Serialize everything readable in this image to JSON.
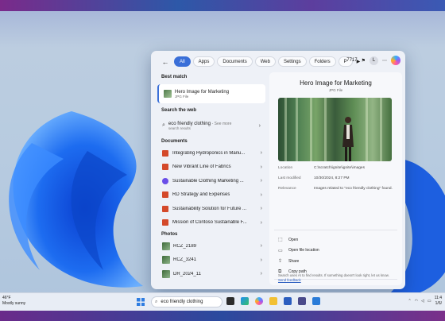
{
  "filters": {
    "tabs": [
      {
        "label": "All",
        "active": true
      },
      {
        "label": "Apps"
      },
      {
        "label": "Documents"
      },
      {
        "label": "Web"
      },
      {
        "label": "Settings"
      },
      {
        "label": "Folders"
      },
      {
        "label": "P"
      }
    ],
    "count": "7717",
    "avatar": "L"
  },
  "best_match": {
    "section": "Best match",
    "title": "Hero Image for Marketing",
    "subtitle": "JPG File"
  },
  "web": {
    "section": "Search the web",
    "query": "eco friendly clothing",
    "more": "- See more",
    "subtitle": "search results"
  },
  "documents": {
    "section": "Documents",
    "items": [
      {
        "label": "Integrating Hydroponics in Manu...",
        "type": "ppt"
      },
      {
        "label": "New Vibrant Line of Fabrics",
        "type": "ppt"
      },
      {
        "label": "Sustainable Clothing Marketing ...",
        "type": "loop"
      },
      {
        "label": "RD Strategy and Expenses",
        "type": "ppt"
      },
      {
        "label": "Sustainability Solution for Future ...",
        "type": "ppt"
      },
      {
        "label": "Mission of Contoso Sustainable F...",
        "type": "ppt"
      }
    ]
  },
  "photos": {
    "section": "Photos",
    "items": [
      {
        "label": "RCZ_2189"
      },
      {
        "label": "RCZ_3241"
      },
      {
        "label": "DR_2024_11"
      }
    ]
  },
  "preview": {
    "title": "Hero Image for Marketing",
    "subtitle": "JPG File",
    "meta": [
      {
        "key": "Location",
        "value": "C:\\scratch\\ignite\\ignite\\images"
      },
      {
        "key": "Last modified",
        "value": "10/30/2024, 8:27 PM"
      },
      {
        "key": "Relevance",
        "value": "Images related to \"eco friendly clothing\" found."
      }
    ],
    "actions": [
      {
        "label": "Open",
        "icon": "open-icon"
      },
      {
        "label": "Open file location",
        "icon": "folder-icon"
      },
      {
        "label": "Share",
        "icon": "share-icon"
      },
      {
        "label": "Copy path",
        "icon": "copy-icon"
      }
    ],
    "feedback_text": "Search uses AI to find results. If something doesn't look right, let us know.",
    "feedback_link": "Send feedback"
  },
  "taskbar": {
    "weather_temp": "46°F",
    "weather_desc": "Mostly sunny",
    "search_text": "eco friendly clothing",
    "time": "11:4",
    "date": "1/6/"
  },
  "colors": {
    "accent": "#3a6fd8",
    "ppt": "#d4492a",
    "word": "#2b5dbf"
  }
}
